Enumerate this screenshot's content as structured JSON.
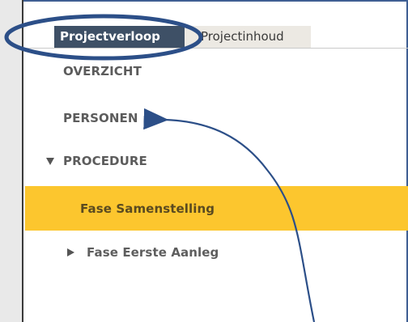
{
  "tabs": {
    "active_label": "Projectverloop",
    "inactive_label": "Projectinhoud"
  },
  "nav": {
    "items": [
      {
        "label": "OVERZICHT"
      },
      {
        "label": "PERSONEN"
      },
      {
        "label": "PROCEDURE"
      },
      {
        "label": "Fase Samenstelling"
      },
      {
        "label": "Fase Eerste Aanleg"
      }
    ]
  },
  "colors": {
    "active_tab_bg": "#3e5066",
    "inactive_tab_bg": "#ece9e3",
    "highlight_row": "#fcc62e",
    "annotation_stroke": "#2c4f88"
  },
  "annotation": {
    "ellipse_target": "tab-projectverloop",
    "arrow_target": "nav-item-personen"
  }
}
